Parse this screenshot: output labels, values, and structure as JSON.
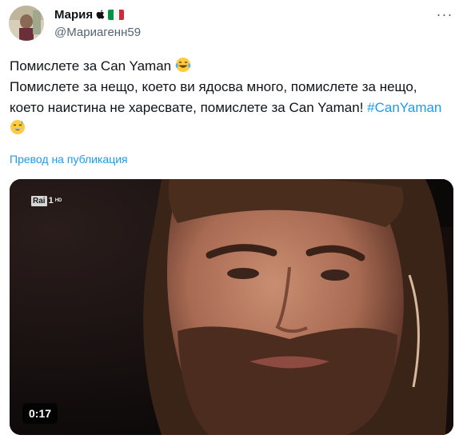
{
  "tweet": {
    "author": {
      "display_name": "Мария",
      "handle": "@Мариагенн59",
      "badges": [
        "apple-icon",
        "italy-flag-icon"
      ],
      "flag_colors": [
        "#009246",
        "#ffffff",
        "#ce2b37"
      ]
    },
    "more_label": "···",
    "line1": "Помислете за Can Yaman ",
    "line1_emoji": "tears-of-joy-emoji",
    "line2": "Помислете за нещо, което ви ядосва много, помислете за нещо, което наистина не харесвате, помислете за Can Yaman! ",
    "hashtag": "#CanYaman",
    "line2_emoji": "grinning-sweat-emoji",
    "translate_label": "Превод на публикация",
    "media": {
      "channel_logo": "Rai",
      "channel_number": "1",
      "channel_hd": "HD",
      "duration": "0:17"
    }
  },
  "colors": {
    "link": "#1d9bf0",
    "text": "#0f1419",
    "secondary": "#536471"
  }
}
